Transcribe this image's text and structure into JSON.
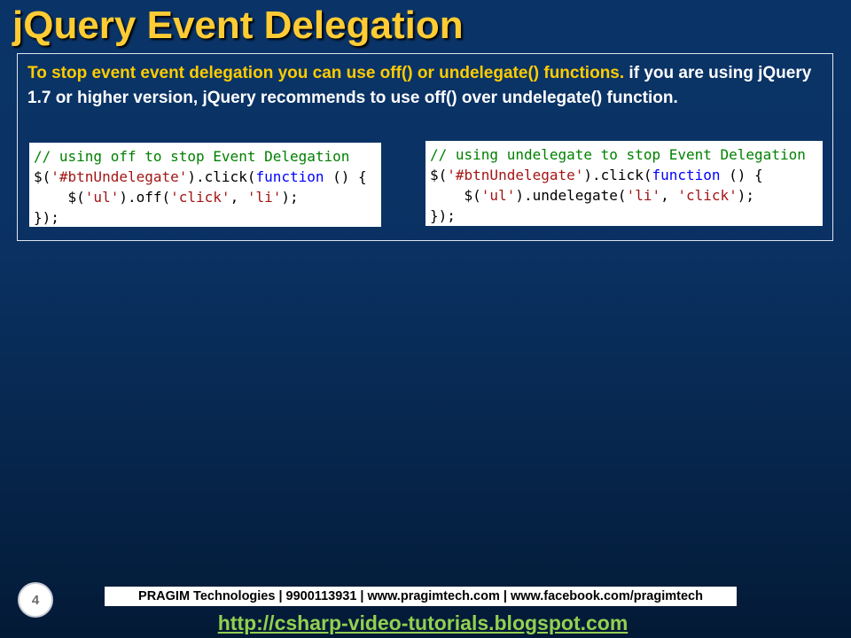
{
  "slide": {
    "title": "jQuery Event Delegation",
    "intro_highlight": "To stop event event delegation you can use off() or undelegate() functions.",
    "intro_rest": " if you are using jQuery 1.7 or higher version, jQuery recommends to use off() over undelegate() function."
  },
  "code_left": {
    "comment": "// using off to stop Event Delegation",
    "l2_a": "$(",
    "l2_s": "'#btnUndelegate'",
    "l2_b": ").click(",
    "l2_k": "function",
    "l2_c": " () {",
    "l3_a": "    $(",
    "l3_s1": "'ul'",
    "l3_b": ").off(",
    "l3_s2": "'click'",
    "l3_c": ", ",
    "l3_s3": "'li'",
    "l3_d": ");",
    "l4": "});"
  },
  "code_right": {
    "comment": "// using undelegate to stop Event Delegation",
    "l2_a": "$(",
    "l2_s": "'#btnUndelegate'",
    "l2_b": ").click(",
    "l2_k": "function",
    "l2_c": " () {",
    "l3_a": "    $(",
    "l3_s1": "'ul'",
    "l3_b": ").undelegate(",
    "l3_s2": "'li'",
    "l3_c": ", ",
    "l3_s3": "'click'",
    "l3_d": ");",
    "l4": "});"
  },
  "footer": {
    "page_number": "4",
    "company_line": "PRAGIM Technologies | 9900113931 | www.pragimtech.com | www.facebook.com/pragimtech",
    "blog_url": "http://csharp-video-tutorials.blogspot.com"
  },
  "colors": {
    "title": "#ffcc33",
    "highlight": "#ffcc00",
    "code_comment": "#008000",
    "code_string": "#a31515",
    "code_keyword": "#0000ff",
    "blog_link": "#92d050"
  }
}
